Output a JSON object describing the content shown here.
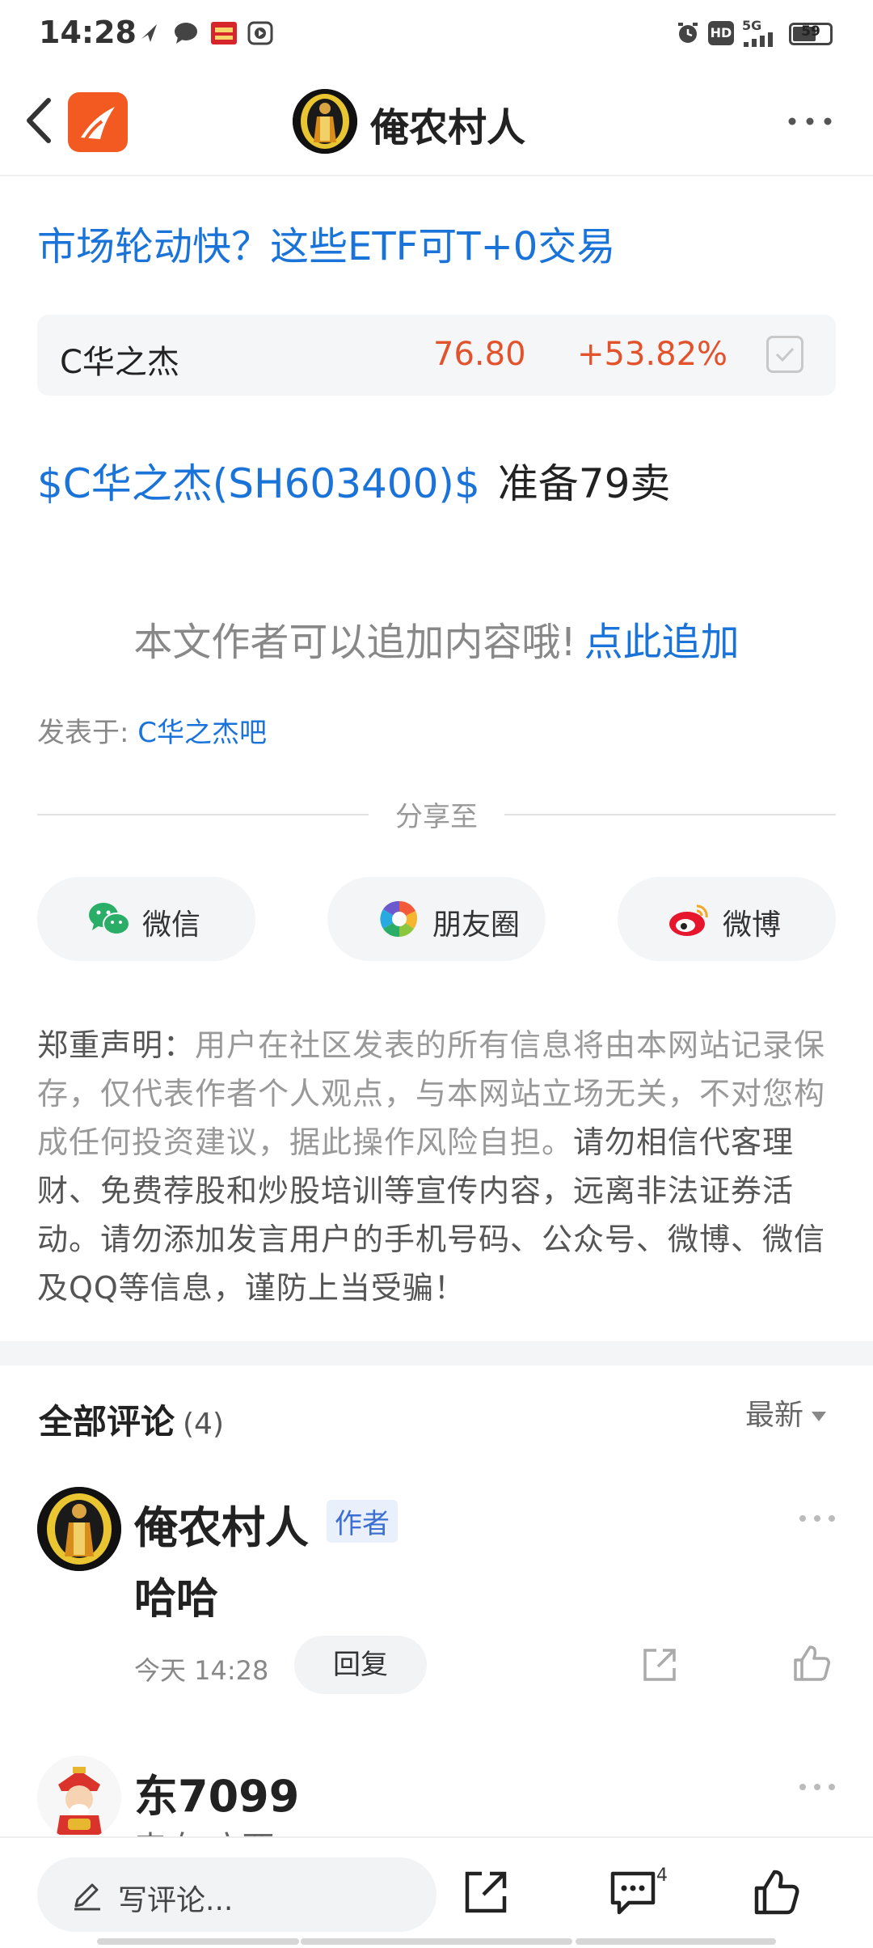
{
  "status_bar": {
    "time": "14:28",
    "battery": "59",
    "network": "5G",
    "hd": "HD"
  },
  "nav": {
    "title": "俺农村人"
  },
  "promo": {
    "title": "市场轮动快？这些ETF可T+0交易"
  },
  "stock_card": {
    "name": "C华之杰",
    "price": "76.80",
    "change": "+53.82%",
    "colors": {
      "up": "#e2522b"
    }
  },
  "post": {
    "stock_tag": "$C华之杰(SH603400)$",
    "text": "准备79卖"
  },
  "append": {
    "text": "本文作者可以追加内容哦!",
    "link": "点此追加"
  },
  "posted_in": {
    "prefix": "发表于: ",
    "bar": "C华之杰吧"
  },
  "share": {
    "label": "分享至",
    "buttons": [
      {
        "label": "微信",
        "icon": "wechat-icon"
      },
      {
        "label": "朋友圈",
        "icon": "moments-icon"
      },
      {
        "label": "微博",
        "icon": "weibo-icon"
      }
    ]
  },
  "disclaimer": {
    "label": "郑重声明：",
    "body_light": "用户在社区发表的所有信息将由本网站记录保存，仅代表作者个人观点，与本网站立场无关，不对您构成任何投资建议，据此操作风险自担。",
    "body_dark": "请勿相信代客理财、免费荐股和炒股培训等宣传内容，远离非法证券活动。请勿添加发言用户的手机号码、公众号、微博、微信及QQ等信息，谨防上当受骗！"
  },
  "comments": {
    "title": "全部评论",
    "count": "(4)",
    "sort": "最新",
    "items": [
      {
        "name": "俺农村人",
        "badge": "作者",
        "content": "哈哈",
        "time": "今天 14:28",
        "reply_label": "回复"
      },
      {
        "name": "东7099",
        "sub": "来自:广西"
      }
    ]
  },
  "bottom_bar": {
    "comment_placeholder": "写评论...",
    "comment_count": "4"
  },
  "colors": {
    "link": "#1a73d9",
    "brand": "#f25a22"
  }
}
